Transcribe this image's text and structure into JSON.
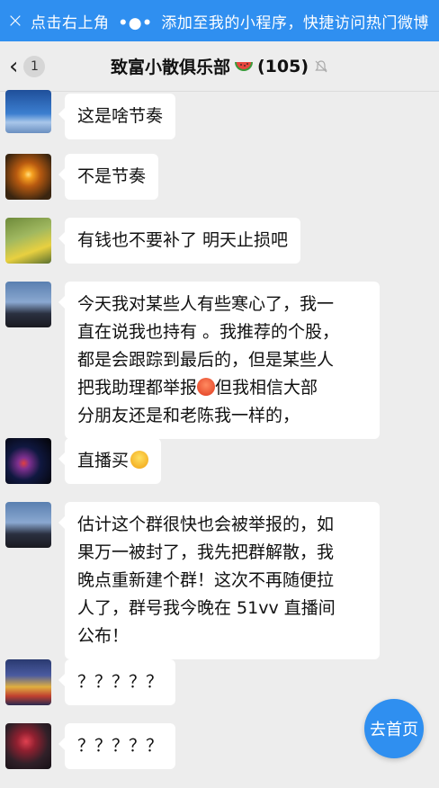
{
  "banner": {
    "close": "×",
    "text_before": "点击右上角",
    "dots": "•●•",
    "text_after": "添加至我的小程序，快捷访问热门微博"
  },
  "header": {
    "back_count": "1",
    "title": "致富小散俱乐部",
    "member_count": "(105)"
  },
  "messages": [
    {
      "text": "这是啥节奏"
    },
    {
      "text": "不是节奏"
    },
    {
      "text": "有钱也不要补了 明天止损吧"
    },
    {
      "lines": [
        "今天我对某些人有些寒心了，我一",
        "直在说我也持有 。我推荐的个股，",
        "都是会跟踪到最后的，但是某些人",
        "把我助理都举报",
        "但我相信大部",
        "分朋友还是和老陈我一样的，"
      ]
    },
    {
      "text": "直播买"
    },
    {
      "lines": [
        "估计这个群很快也会被举报的，如",
        "果万一被封了，我先把群解散，我",
        "晚点重新建个群！这次不再随便拉",
        "人了，群号我今晚在 51vv 直播间",
        "公布！"
      ]
    },
    {
      "text": "？？？？？"
    },
    {
      "text": "？？？？？"
    }
  ],
  "home_button": "去首页",
  "colors": {
    "accent": "#2f8ff0",
    "background": "#ededed",
    "bubble": "#ffffff"
  }
}
